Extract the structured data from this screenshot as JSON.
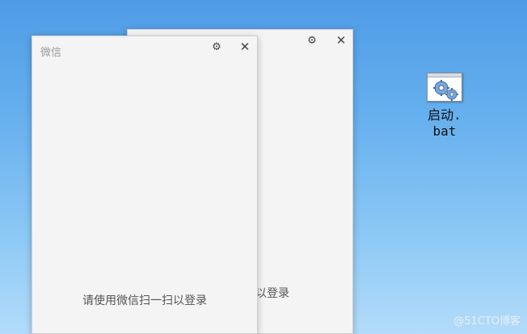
{
  "windows": {
    "back": {
      "settings_icon": "gear-icon",
      "close_label": "✕",
      "login_prompt": "请使用微信扫一扫以登录"
    },
    "front": {
      "title": "微信",
      "settings_icon": "gear-icon",
      "close_label": "✕",
      "login_prompt": "请使用微信扫一扫以登录"
    }
  },
  "desktop": {
    "shortcut": {
      "icon": "batch-file-icon",
      "label_line1": "启动.",
      "label_line2": "bat"
    },
    "watermark": "@51CTO博客"
  }
}
